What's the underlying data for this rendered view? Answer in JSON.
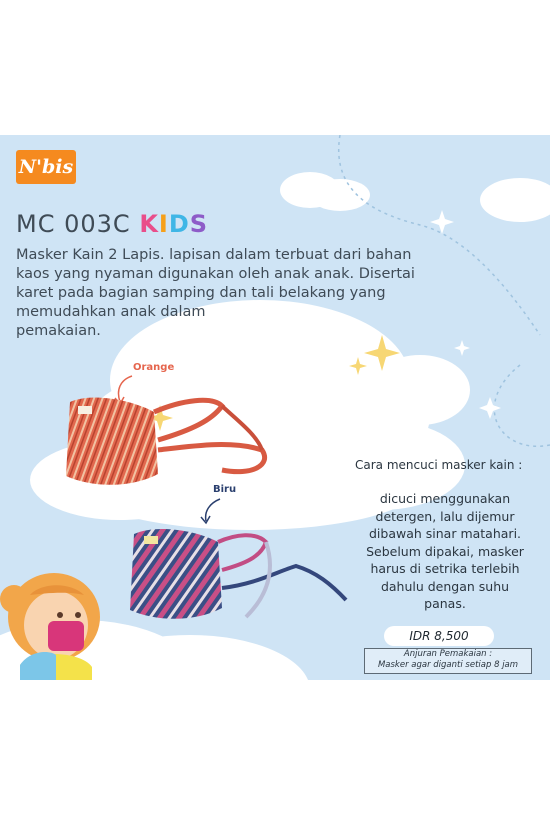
{
  "brand": {
    "logo_text": "N'bis"
  },
  "product": {
    "code": "MC 003C",
    "kids_letters": [
      "K",
      "I",
      "D",
      "S"
    ],
    "kids_colors": [
      "#e94e8a",
      "#f6a01a",
      "#3fb6e6",
      "#8e5cc8"
    ],
    "description_lines": [
      "Masker Kain 2 Lapis. lapisan dalam terbuat dari bahan",
      "kaos yang nyaman digunakan oleh anak anak. Disertai",
      "karet pada bagian samping dan tali belakang yang",
      "memudahkan anak dalam",
      "pemakaian."
    ]
  },
  "variants": [
    {
      "label": "Orange",
      "color": "#e5654d"
    },
    {
      "label": "Biru",
      "color": "#2a3f6e"
    }
  ],
  "washing": {
    "title": "Cara mencuci masker kain :",
    "lines": [
      "dicuci menggunakan",
      "detergen, lalu dijemur",
      "dibawah sinar matahari.",
      "Sebelum dipakai, masker",
      "harus di setrika terlebih",
      "dahulu dengan suhu",
      "panas."
    ]
  },
  "price": "IDR 8,500",
  "note": {
    "line1": "Anjuran Pemakaian :",
    "line2": "Masker agar diganti setiap 8 jam"
  },
  "colors": {
    "sky": "#cfe4f5",
    "cloud": "#ffffff",
    "text": "#3f4b56",
    "star": "#f7d774"
  }
}
